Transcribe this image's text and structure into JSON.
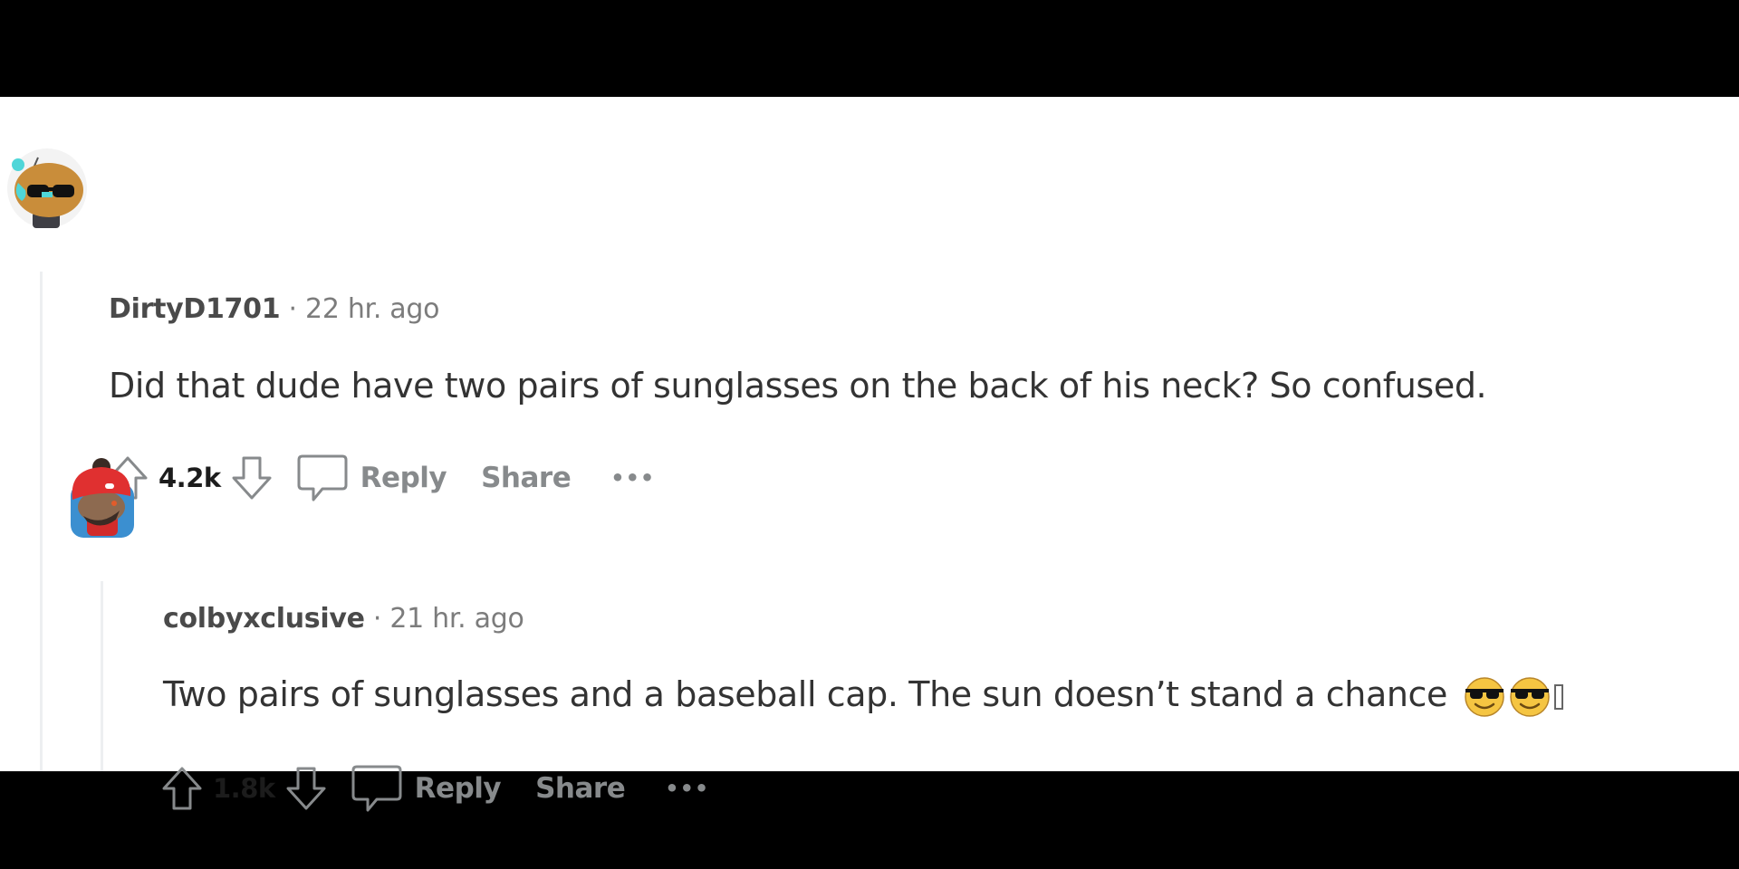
{
  "comments": [
    {
      "avatar": "snoo-avatar-sunglasses",
      "username": "DirtyD1701",
      "separator": "·",
      "timestamp": "22 hr. ago",
      "body": "Did that dude have two pairs of sunglasses on the back of his neck? So confused.",
      "score": "4.2k",
      "reply_label": "Reply",
      "share_label": "Share",
      "more_label": "•••"
    },
    {
      "avatar": "snoo-avatar-red-beanie",
      "username": "colbyxclusive",
      "separator": "·",
      "timestamp": "21 hr. ago",
      "body": "Two pairs of sunglasses and a baseball cap. The sun doesn’t stand a chance",
      "emojis": [
        "smiling-face-with-sunglasses",
        "smiling-face-with-sunglasses"
      ],
      "score": "1.8k",
      "reply_label": "Reply",
      "share_label": "Share",
      "more_label": "•••"
    }
  ]
}
